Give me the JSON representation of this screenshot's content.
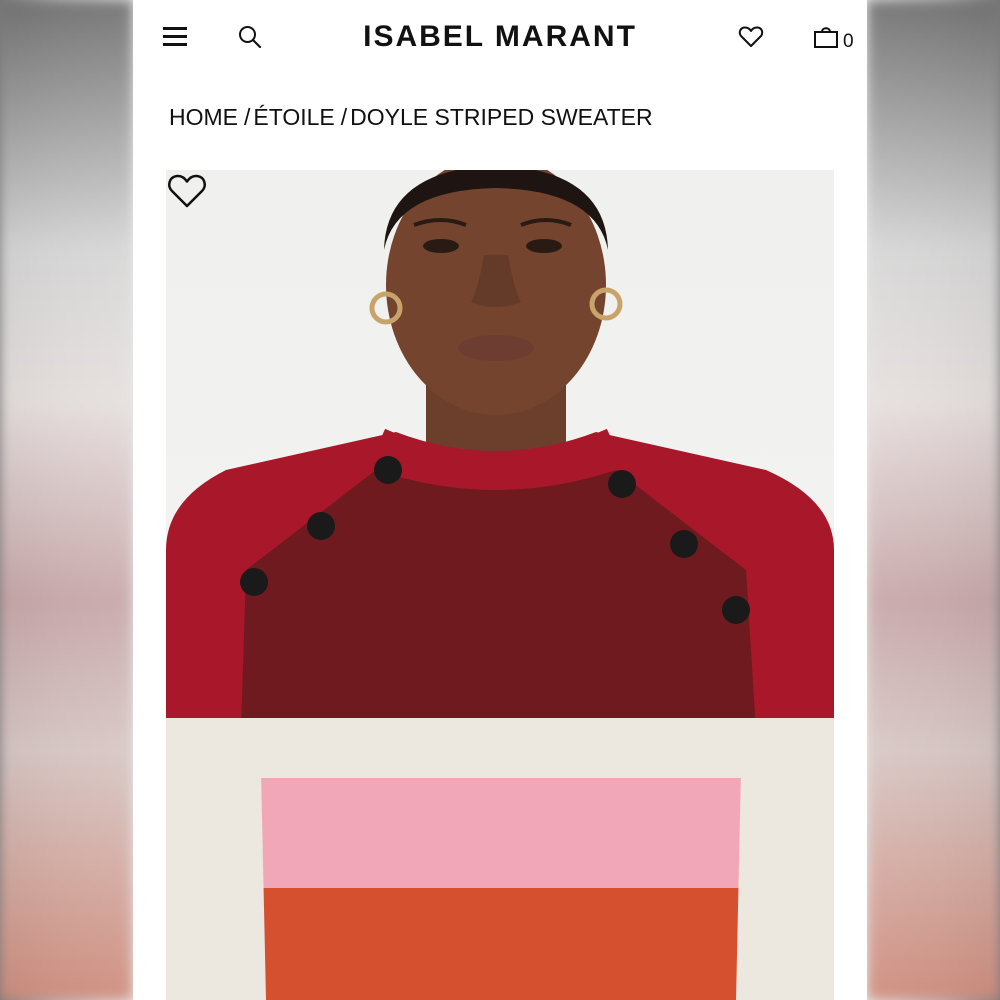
{
  "header": {
    "brand": "ISABEL MARANT",
    "menu_icon": "hamburger-menu-icon",
    "search_icon": "search-icon",
    "wishlist_icon": "heart-icon",
    "bag_icon": "shopping-bag-icon",
    "bag_count": "0"
  },
  "breadcrumb": {
    "items": [
      "HOME",
      "ÉTOILE",
      "DOYLE STRIPED SWEATER"
    ],
    "separator": "/"
  },
  "product": {
    "image_alt_icon": "product-photo",
    "wishlist_icon": "heart-icon",
    "sweater_colors": {
      "red": "#a8182a",
      "burgundy": "#6e1a1f",
      "cream": "#ece7df",
      "pink": "#f2a7b8",
      "orange": "#d4502e",
      "buttons": "#1a1a1a"
    }
  }
}
